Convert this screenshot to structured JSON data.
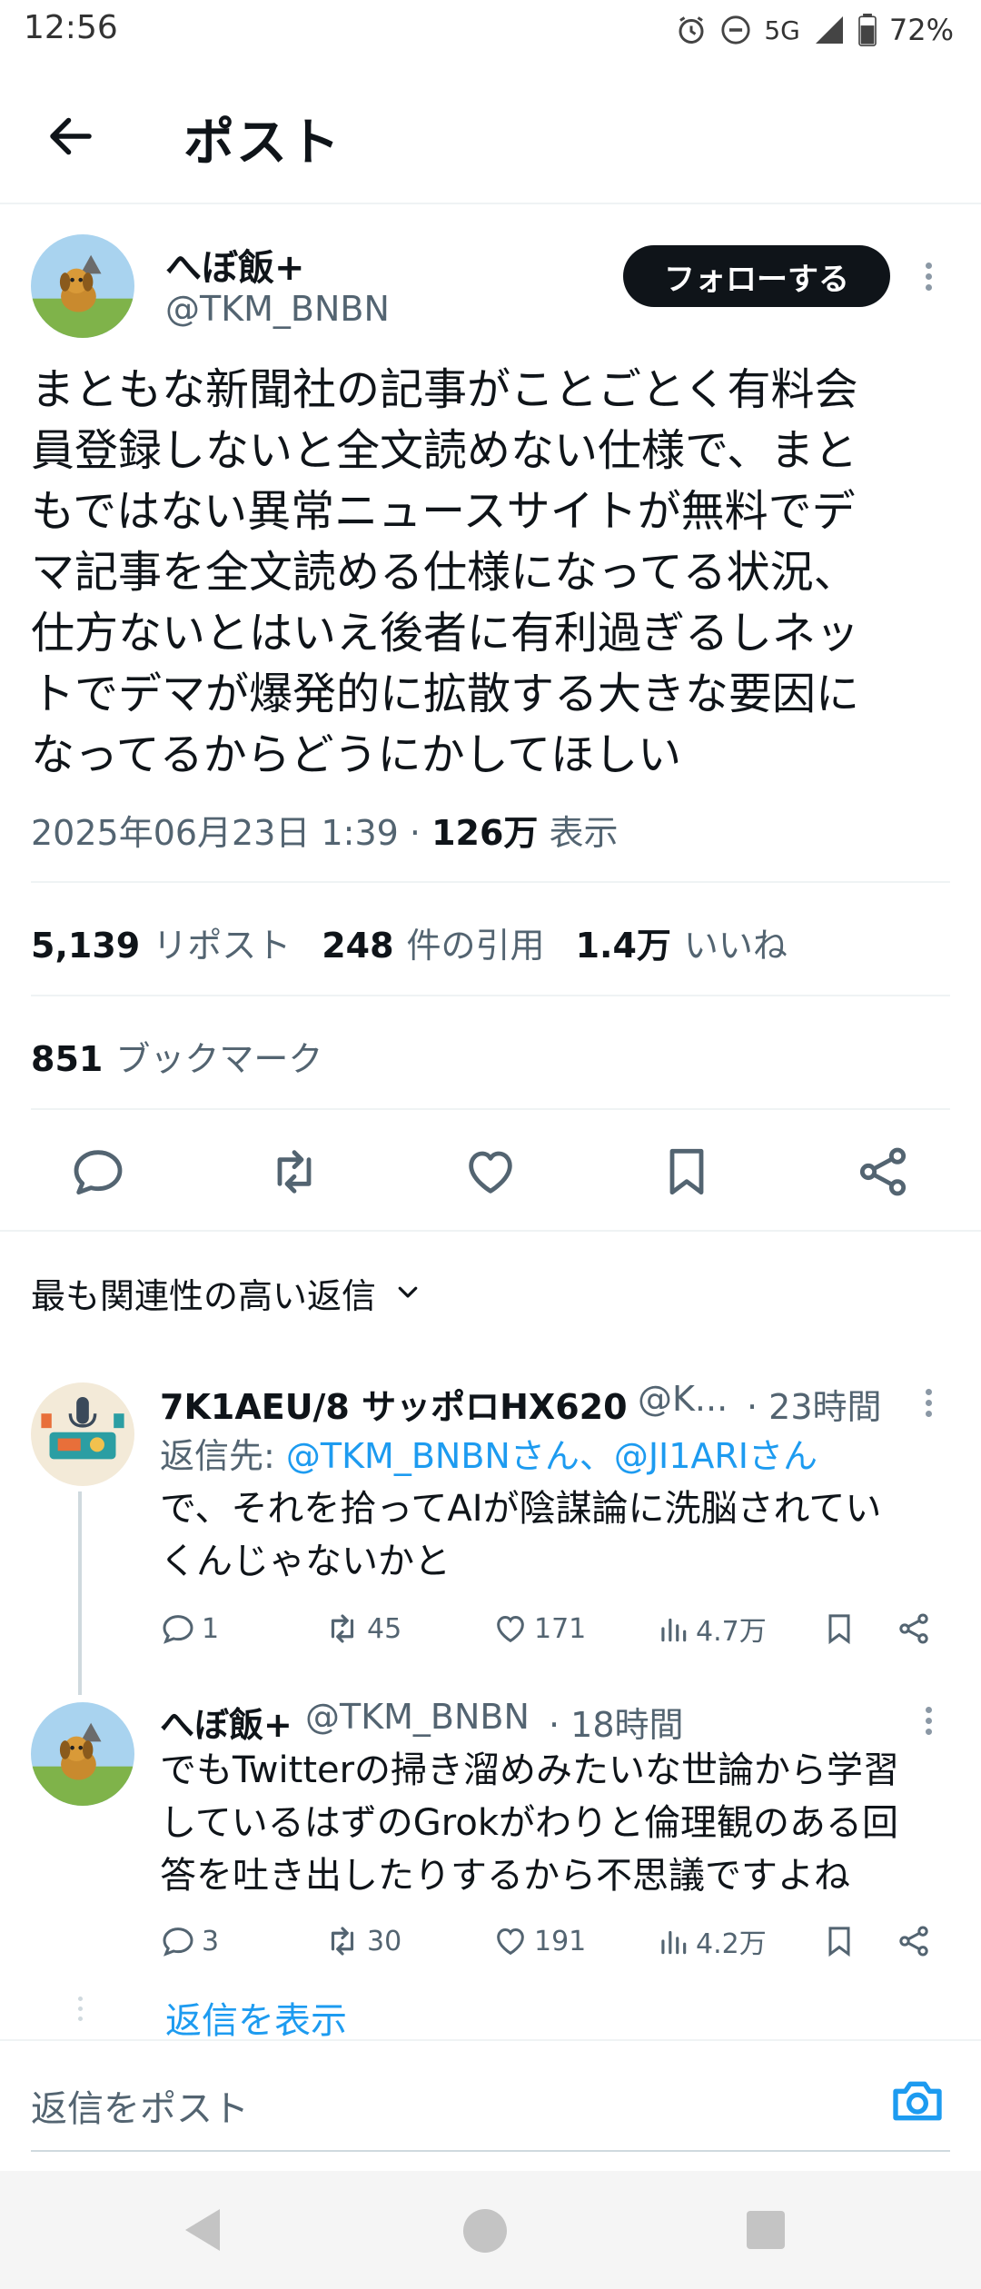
{
  "status_bar": {
    "time": "12:56",
    "network": "5G",
    "battery": "72%"
  },
  "header": {
    "title": "ポスト"
  },
  "post": {
    "author_name": "へぼ飯+",
    "author_handle": "@TKM_BNBN",
    "follow_label": "フォローする",
    "text": "まともな新聞社の記事がことごとく有料会\n員登録しないと全文読めない仕様で、まと\nもではない異常ニュースサイトが無料でデ\nマ記事を全文読める仕様になってる状況、\n仕方ないとはいえ後者に有利過ぎるしネッ\nトでデマが爆発的に拡散する大きな要因に\nなってるからどうにかしてほしい",
    "datetime": "2025年06月23日 1:39",
    "views_count": "126万",
    "views_label": "表示",
    "reposts_count": "5,139",
    "reposts_label": "リポスト",
    "quotes_count": "248",
    "quotes_label": "件の引用",
    "likes_count": "1.4万",
    "likes_label": "いいね",
    "bookmarks_count": "851",
    "bookmarks_label": "ブックマーク"
  },
  "sort_label": "最も関連性の高い返信",
  "replies": [
    {
      "name": "7K1AEU/8 サッポロHX620",
      "handle": "@K...",
      "time": "· 23時間",
      "reply_to_prefix": "返信先:",
      "reply_to_links": "@TKM_BNBNさん、@JI1ARIさん",
      "text": "で、それを拾ってAIが陰謀論に洗脳されてい\nくんじゃないかと",
      "replies": "1",
      "reposts": "45",
      "likes": "171",
      "views": "4.7万"
    },
    {
      "name": "へぼ飯+",
      "handle": "@TKM_BNBN",
      "time": "· 18時間",
      "text": "でもTwitterの掃き溜めみたいな世論から学習\nしているはずのGrokがわりと倫理観のある回\n答を吐き出したりするから不思議ですよね",
      "replies": "3",
      "reposts": "30",
      "likes": "191",
      "views": "4.2万"
    }
  ],
  "show_replies_label": "返信を表示",
  "compose_placeholder": "返信をポスト",
  "colors": {
    "accent": "#1d9bf0",
    "text": "#0f1419",
    "secondary": "#536471"
  }
}
